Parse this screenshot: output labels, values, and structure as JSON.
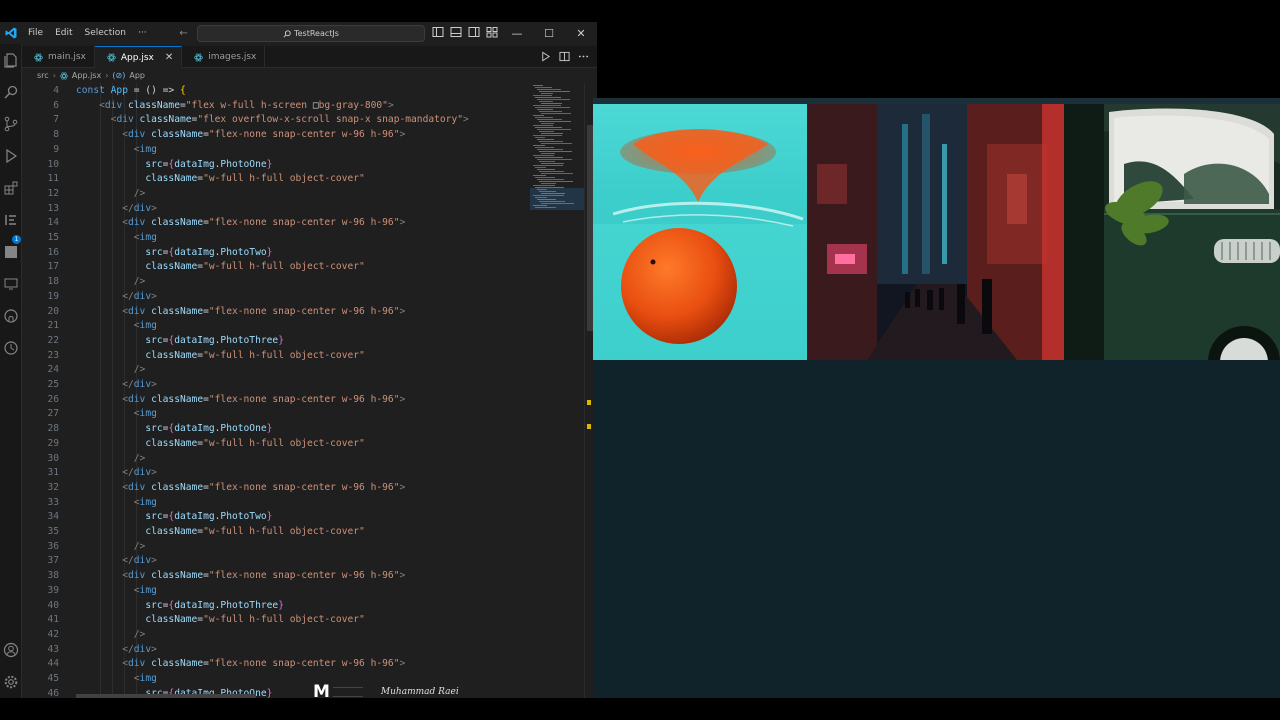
{
  "titlebar": {
    "menu": [
      "File",
      "Edit",
      "Selection",
      "···"
    ],
    "search_text": "TestReactJs"
  },
  "tabs": [
    {
      "label": "main.jsx",
      "active": false
    },
    {
      "label": "App.jsx",
      "active": true,
      "close": "✕"
    },
    {
      "label": "images.jsx",
      "active": false
    }
  ],
  "breadcrumb": {
    "folder": "src",
    "file": "App.jsx",
    "symbol": "App"
  },
  "editor": {
    "lines": [
      {
        "n": "4",
        "tokens": [
          [
            "t-kw",
            "const "
          ],
          [
            "t-var",
            "App"
          ],
          [
            "t-pun",
            " = () => "
          ],
          [
            "t-cur2",
            "{"
          ]
        ]
      },
      {
        "n": "6",
        "tokens": [
          [
            "t-pun",
            "    "
          ],
          [
            "t-br",
            "<"
          ],
          [
            "t-tag",
            "div "
          ],
          [
            "t-attr",
            "className"
          ],
          [
            "t-pun",
            "="
          ],
          [
            "t-str",
            "\"flex w-full h-screen "
          ],
          [
            "t-pun",
            "□"
          ],
          [
            "t-str",
            "bg-gray-800\""
          ],
          [
            "t-br",
            ">"
          ]
        ]
      },
      {
        "n": "7",
        "tokens": [
          [
            "t-pun",
            "      "
          ],
          [
            "t-br",
            "<"
          ],
          [
            "t-tag",
            "div "
          ],
          [
            "t-attr",
            "className"
          ],
          [
            "t-pun",
            "="
          ],
          [
            "t-str",
            "\"flex overflow-x-scroll snap-x snap-mandatory\""
          ],
          [
            "t-br",
            ">"
          ]
        ]
      },
      {
        "n": "8",
        "tokens": [
          [
            "t-pun",
            "        "
          ],
          [
            "t-br",
            "<"
          ],
          [
            "t-tag",
            "div "
          ],
          [
            "t-attr",
            "className"
          ],
          [
            "t-pun",
            "="
          ],
          [
            "t-str",
            "\"flex-none snap-center w-96 h-96\""
          ],
          [
            "t-br",
            ">"
          ]
        ]
      },
      {
        "n": "9",
        "tokens": [
          [
            "t-pun",
            "          "
          ],
          [
            "t-br",
            "<"
          ],
          [
            "t-tag",
            "img"
          ]
        ]
      },
      {
        "n": "10",
        "tokens": [
          [
            "t-pun",
            "            "
          ],
          [
            "t-attr",
            "src"
          ],
          [
            "t-pun",
            "="
          ],
          [
            "t-cur",
            "{"
          ],
          [
            "t-prop",
            "dataImg"
          ],
          [
            "t-pun",
            "."
          ],
          [
            "t-prop",
            "PhotoOne"
          ],
          [
            "t-cur",
            "}"
          ]
        ]
      },
      {
        "n": "11",
        "tokens": [
          [
            "t-pun",
            "            "
          ],
          [
            "t-attr",
            "className"
          ],
          [
            "t-pun",
            "="
          ],
          [
            "t-str",
            "\"w-full h-full object-cover\""
          ]
        ]
      },
      {
        "n": "12",
        "tokens": [
          [
            "t-pun",
            "          "
          ],
          [
            "t-br",
            "/>"
          ]
        ]
      },
      {
        "n": "13",
        "tokens": [
          [
            "t-pun",
            "        "
          ],
          [
            "t-br",
            "</"
          ],
          [
            "t-tag",
            "div"
          ],
          [
            "t-br",
            ">"
          ]
        ]
      },
      {
        "n": "14",
        "tokens": [
          [
            "t-pun",
            "        "
          ],
          [
            "t-br",
            "<"
          ],
          [
            "t-tag",
            "div "
          ],
          [
            "t-attr",
            "className"
          ],
          [
            "t-pun",
            "="
          ],
          [
            "t-str",
            "\"flex-none snap-center w-96 h-96\""
          ],
          [
            "t-br",
            ">"
          ]
        ]
      },
      {
        "n": "15",
        "tokens": [
          [
            "t-pun",
            "          "
          ],
          [
            "t-br",
            "<"
          ],
          [
            "t-tag",
            "img"
          ]
        ]
      },
      {
        "n": "16",
        "tokens": [
          [
            "t-pun",
            "            "
          ],
          [
            "t-attr",
            "src"
          ],
          [
            "t-pun",
            "="
          ],
          [
            "t-cur",
            "{"
          ],
          [
            "t-prop",
            "dataImg"
          ],
          [
            "t-pun",
            "."
          ],
          [
            "t-prop",
            "PhotoTwo"
          ],
          [
            "t-cur",
            "}"
          ]
        ]
      },
      {
        "n": "17",
        "tokens": [
          [
            "t-pun",
            "            "
          ],
          [
            "t-attr",
            "className"
          ],
          [
            "t-pun",
            "="
          ],
          [
            "t-str",
            "\"w-full h-full object-cover\""
          ]
        ]
      },
      {
        "n": "18",
        "tokens": [
          [
            "t-pun",
            "          "
          ],
          [
            "t-br",
            "/>"
          ]
        ]
      },
      {
        "n": "19",
        "tokens": [
          [
            "t-pun",
            "        "
          ],
          [
            "t-br",
            "</"
          ],
          [
            "t-tag",
            "div"
          ],
          [
            "t-br",
            ">"
          ]
        ]
      },
      {
        "n": "20",
        "tokens": [
          [
            "t-pun",
            "        "
          ],
          [
            "t-br",
            "<"
          ],
          [
            "t-tag",
            "div "
          ],
          [
            "t-attr",
            "className"
          ],
          [
            "t-pun",
            "="
          ],
          [
            "t-str",
            "\"flex-none snap-center w-96 h-96\""
          ],
          [
            "t-br",
            ">"
          ]
        ]
      },
      {
        "n": "21",
        "tokens": [
          [
            "t-pun",
            "          "
          ],
          [
            "t-br",
            "<"
          ],
          [
            "t-tag",
            "img"
          ]
        ]
      },
      {
        "n": "22",
        "tokens": [
          [
            "t-pun",
            "            "
          ],
          [
            "t-attr",
            "src"
          ],
          [
            "t-pun",
            "="
          ],
          [
            "t-cur",
            "{"
          ],
          [
            "t-prop",
            "dataImg"
          ],
          [
            "t-pun",
            "."
          ],
          [
            "t-prop",
            "PhotoThree"
          ],
          [
            "t-cur",
            "}"
          ]
        ]
      },
      {
        "n": "23",
        "tokens": [
          [
            "t-pun",
            "            "
          ],
          [
            "t-attr",
            "className"
          ],
          [
            "t-pun",
            "="
          ],
          [
            "t-str",
            "\"w-full h-full object-cover\""
          ]
        ]
      },
      {
        "n": "24",
        "tokens": [
          [
            "t-pun",
            "          "
          ],
          [
            "t-br",
            "/>"
          ]
        ]
      },
      {
        "n": "25",
        "tokens": [
          [
            "t-pun",
            "        "
          ],
          [
            "t-br",
            "</"
          ],
          [
            "t-tag",
            "div"
          ],
          [
            "t-br",
            ">"
          ]
        ]
      },
      {
        "n": "26",
        "tokens": [
          [
            "t-pun",
            "        "
          ],
          [
            "t-br",
            "<"
          ],
          [
            "t-tag",
            "div "
          ],
          [
            "t-attr",
            "className"
          ],
          [
            "t-pun",
            "="
          ],
          [
            "t-str",
            "\"flex-none snap-center w-96 h-96\""
          ],
          [
            "t-br",
            ">"
          ]
        ]
      },
      {
        "n": "27",
        "tokens": [
          [
            "t-pun",
            "          "
          ],
          [
            "t-br",
            "<"
          ],
          [
            "t-tag",
            "img"
          ]
        ]
      },
      {
        "n": "28",
        "tokens": [
          [
            "t-pun",
            "            "
          ],
          [
            "t-attr",
            "src"
          ],
          [
            "t-pun",
            "="
          ],
          [
            "t-cur",
            "{"
          ],
          [
            "t-prop",
            "dataImg"
          ],
          [
            "t-pun",
            "."
          ],
          [
            "t-prop",
            "PhotoOne"
          ],
          [
            "t-cur",
            "}"
          ]
        ]
      },
      {
        "n": "29",
        "tokens": [
          [
            "t-pun",
            "            "
          ],
          [
            "t-attr",
            "className"
          ],
          [
            "t-pun",
            "="
          ],
          [
            "t-str",
            "\"w-full h-full object-cover\""
          ]
        ]
      },
      {
        "n": "30",
        "tokens": [
          [
            "t-pun",
            "          "
          ],
          [
            "t-br",
            "/>"
          ]
        ]
      },
      {
        "n": "31",
        "tokens": [
          [
            "t-pun",
            "        "
          ],
          [
            "t-br",
            "</"
          ],
          [
            "t-tag",
            "div"
          ],
          [
            "t-br",
            ">"
          ]
        ]
      },
      {
        "n": "32",
        "tokens": [
          [
            "t-pun",
            "        "
          ],
          [
            "t-br",
            "<"
          ],
          [
            "t-tag",
            "div "
          ],
          [
            "t-attr",
            "className"
          ],
          [
            "t-pun",
            "="
          ],
          [
            "t-str",
            "\"flex-none snap-center w-96 h-96\""
          ],
          [
            "t-br",
            ">"
          ]
        ]
      },
      {
        "n": "33",
        "tokens": [
          [
            "t-pun",
            "          "
          ],
          [
            "t-br",
            "<"
          ],
          [
            "t-tag",
            "img"
          ]
        ]
      },
      {
        "n": "34",
        "tokens": [
          [
            "t-pun",
            "            "
          ],
          [
            "t-attr",
            "src"
          ],
          [
            "t-pun",
            "="
          ],
          [
            "t-cur",
            "{"
          ],
          [
            "t-prop",
            "dataImg"
          ],
          [
            "t-pun",
            "."
          ],
          [
            "t-prop",
            "PhotoTwo"
          ],
          [
            "t-cur",
            "}"
          ]
        ]
      },
      {
        "n": "35",
        "tokens": [
          [
            "t-pun",
            "            "
          ],
          [
            "t-attr",
            "className"
          ],
          [
            "t-pun",
            "="
          ],
          [
            "t-str",
            "\"w-full h-full object-cover\""
          ]
        ]
      },
      {
        "n": "36",
        "tokens": [
          [
            "t-pun",
            "          "
          ],
          [
            "t-br",
            "/>"
          ]
        ]
      },
      {
        "n": "37",
        "tokens": [
          [
            "t-pun",
            "        "
          ],
          [
            "t-br",
            "</"
          ],
          [
            "t-tag",
            "div"
          ],
          [
            "t-br",
            ">"
          ]
        ]
      },
      {
        "n": "38",
        "tokens": [
          [
            "t-pun",
            "        "
          ],
          [
            "t-br",
            "<"
          ],
          [
            "t-tag",
            "div "
          ],
          [
            "t-attr",
            "className"
          ],
          [
            "t-pun",
            "="
          ],
          [
            "t-str",
            "\"flex-none snap-center w-96 h-96\""
          ],
          [
            "t-br",
            ">"
          ]
        ]
      },
      {
        "n": "39",
        "tokens": [
          [
            "t-pun",
            "          "
          ],
          [
            "t-br",
            "<"
          ],
          [
            "t-tag",
            "img"
          ]
        ]
      },
      {
        "n": "40",
        "tokens": [
          [
            "t-pun",
            "            "
          ],
          [
            "t-attr",
            "src"
          ],
          [
            "t-pun",
            "="
          ],
          [
            "t-cur",
            "{"
          ],
          [
            "t-prop",
            "dataImg"
          ],
          [
            "t-pun",
            "."
          ],
          [
            "t-prop",
            "PhotoThree"
          ],
          [
            "t-cur",
            "}"
          ]
        ]
      },
      {
        "n": "41",
        "tokens": [
          [
            "t-pun",
            "            "
          ],
          [
            "t-attr",
            "className"
          ],
          [
            "t-pun",
            "="
          ],
          [
            "t-str",
            "\"w-full h-full object-cover\""
          ]
        ]
      },
      {
        "n": "42",
        "tokens": [
          [
            "t-pun",
            "          "
          ],
          [
            "t-br",
            "/>"
          ]
        ]
      },
      {
        "n": "43",
        "tokens": [
          [
            "t-pun",
            "        "
          ],
          [
            "t-br",
            "</"
          ],
          [
            "t-tag",
            "div"
          ],
          [
            "t-br",
            ">"
          ]
        ]
      },
      {
        "n": "44",
        "tokens": [
          [
            "t-pun",
            "        "
          ],
          [
            "t-br",
            "<"
          ],
          [
            "t-tag",
            "div "
          ],
          [
            "t-attr",
            "className"
          ],
          [
            "t-pun",
            "="
          ],
          [
            "t-str",
            "\"flex-none snap-center w-96 h-96\""
          ],
          [
            "t-br",
            ">"
          ]
        ]
      },
      {
        "n": "45",
        "tokens": [
          [
            "t-pun",
            "          "
          ],
          [
            "t-br",
            "<"
          ],
          [
            "t-tag",
            "img"
          ]
        ]
      },
      {
        "n": "46",
        "tokens": [
          [
            "t-pun",
            "            "
          ],
          [
            "t-attr",
            "src"
          ],
          [
            "t-pun",
            "="
          ],
          [
            "t-cur",
            "{"
          ],
          [
            "t-prop",
            "dataImg"
          ],
          [
            "t-pun",
            "."
          ],
          [
            "t-prop",
            "PhotoOne"
          ],
          [
            "t-cur",
            "}"
          ]
        ]
      }
    ]
  },
  "watermark": {
    "logo": "M",
    "signature": "Muhammad Raei"
  },
  "preview": {
    "photos": [
      {
        "name": "PhotoOne",
        "subject": "orange-in-water"
      },
      {
        "name": "PhotoTwo",
        "subject": "night-city-street"
      },
      {
        "name": "PhotoThree",
        "subject": "green-vintage-car"
      }
    ]
  },
  "colors": {
    "editor_bg": "#1f1f1f",
    "accent": "#0078d4",
    "preview_bg": "#10222a"
  }
}
